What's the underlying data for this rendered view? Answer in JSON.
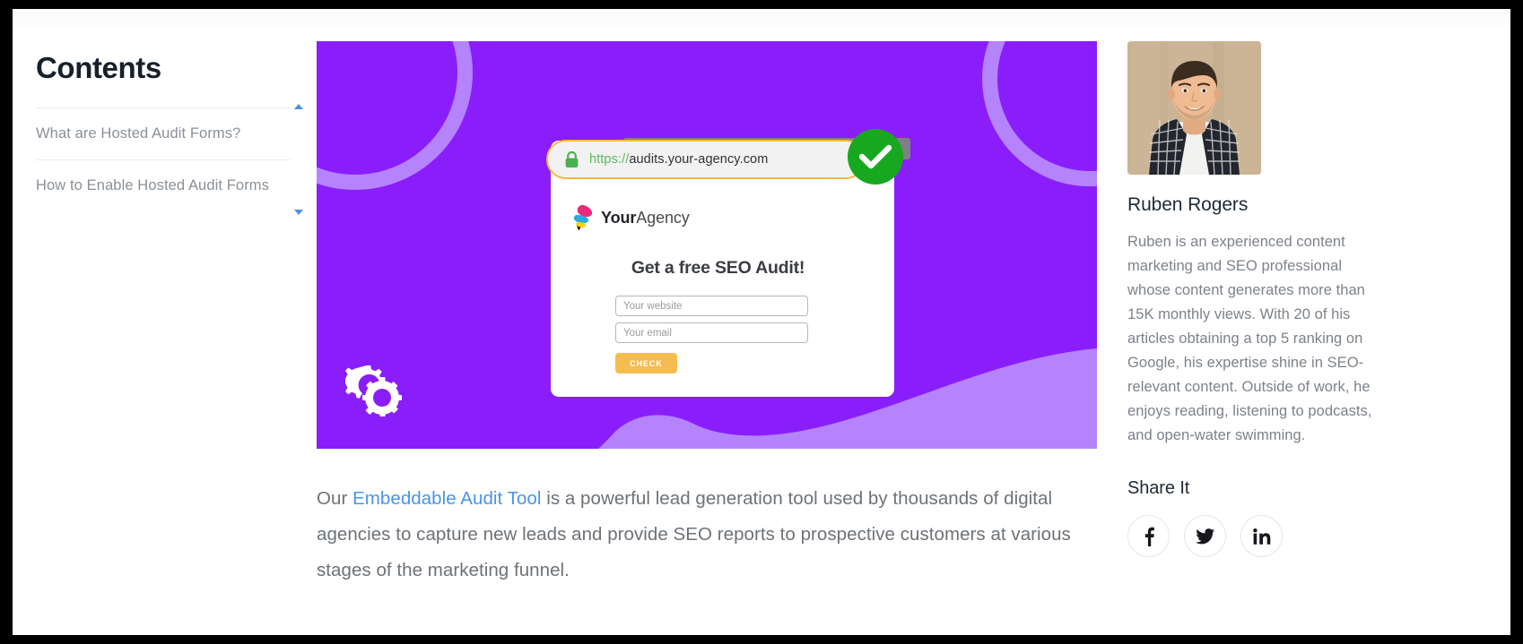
{
  "toc": {
    "title": "Contents",
    "items": [
      {
        "label": "What are Hosted Audit Forms?"
      },
      {
        "label": "How to Enable Hosted Audit Forms"
      }
    ],
    "scroll_up_icon": "triangle-up-icon",
    "scroll_down_icon": "triangle-down-icon"
  },
  "hero": {
    "background_color": "#8A1EFB",
    "accent_color": "#B584FD",
    "decor_icon": "gears-icon",
    "browser": {
      "url": "https://audits.your-agency.com",
      "url_scheme": "https://",
      "url_host": "audits.your-agency.com",
      "lock_icon": "lock-icon",
      "secure_badge_icon": "green-check-icon",
      "urlbar_border_color": "#F6B93B",
      "check_badge_color": "#18A820"
    },
    "brand": {
      "logo_icon": "youragency-logo-icon",
      "name_bold": "Your",
      "name_rest": "Agency"
    },
    "form": {
      "heading": "Get a free SEO Audit!",
      "website_placeholder": "Your website",
      "email_placeholder": "Your email",
      "website_value": "",
      "email_value": "",
      "submit_label": "CHECK",
      "submit_color": "#F6BC4F"
    }
  },
  "article": {
    "paragraph_prefix": "Our ",
    "link_text": "Embeddable Audit Tool",
    "link_color": "#4A94EA",
    "paragraph_rest": " is a powerful lead generation tool used by thousands of digital agencies to capture new leads and provide SEO reports to prospective customers at various stages of the marketing funnel."
  },
  "author": {
    "avatar_alt": "Ruben Rogers headshot",
    "name": "Ruben Rogers",
    "bio": "Ruben is an experienced content marketing and SEO professional whose content generates more than 15K monthly views. With 20 of his articles obtaining a top 5 ranking on Google, his expertise shine in SEO-relevant content. Outside of work, he enjoys reading, listening to podcasts, and open-water swimming."
  },
  "share": {
    "title": "Share It",
    "buttons": [
      {
        "name": "facebook",
        "icon": "facebook-icon"
      },
      {
        "name": "twitter",
        "icon": "twitter-icon"
      },
      {
        "name": "linkedin",
        "icon": "linkedin-icon"
      }
    ]
  }
}
